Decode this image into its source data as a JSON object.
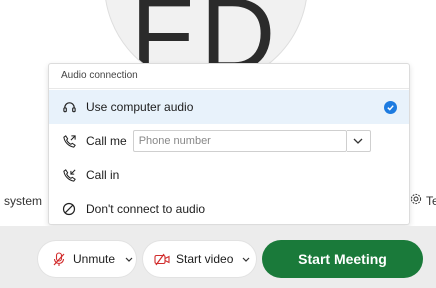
{
  "avatar": {
    "initials": "FD"
  },
  "side": {
    "left_text": "system",
    "right_text": "Te"
  },
  "audio_panel": {
    "header": "Audio connection",
    "options": [
      {
        "label": "Use computer audio",
        "icon": "headset-icon",
        "selected": true
      },
      {
        "label": "Call me",
        "icon": "phone-outgoing-icon",
        "selected": false
      },
      {
        "label": "Call in",
        "icon": "phone-incoming-icon",
        "selected": false
      },
      {
        "label": "Don't connect to audio",
        "icon": "no-audio-icon",
        "selected": false
      }
    ],
    "phone_placeholder": "Phone number"
  },
  "controls": {
    "unmute_label": "Unmute",
    "start_video_label": "Start video",
    "start_meeting_label": "Start Meeting"
  },
  "colors": {
    "accent_blue": "#1d7be0",
    "selected_bg": "#e8f2fb",
    "start_green": "#1a7a3a",
    "mute_red": "#d12c2c",
    "bar_bg": "#ececec"
  }
}
